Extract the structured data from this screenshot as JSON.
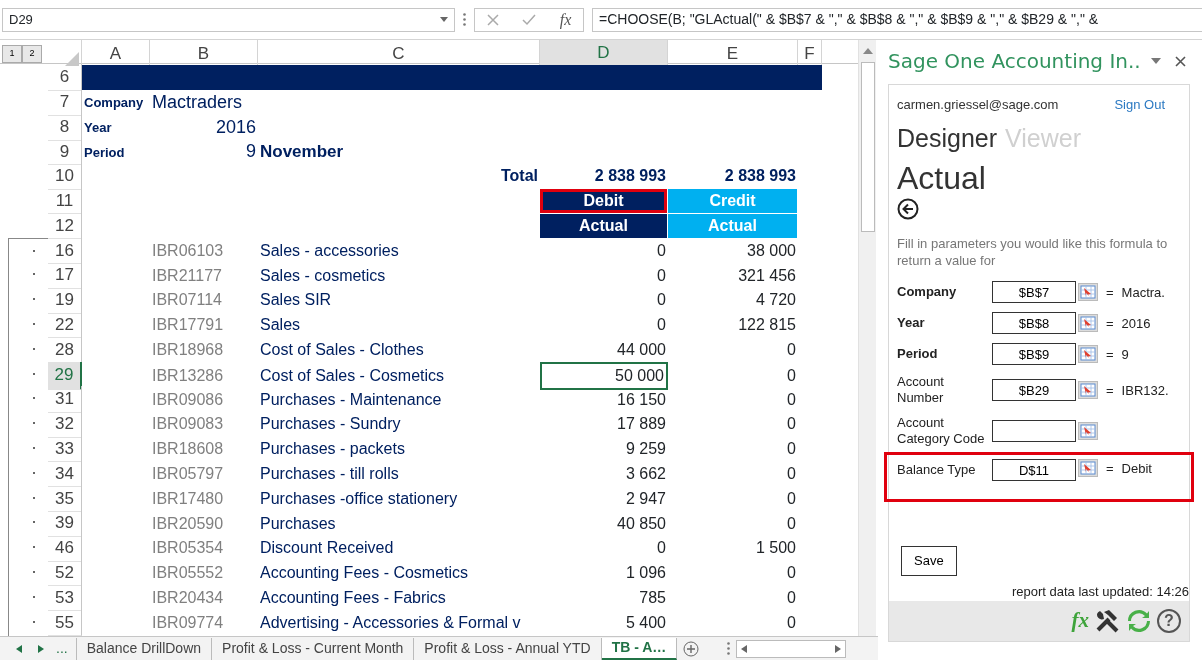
{
  "formula_bar": {
    "name_box": "D29",
    "function_label": "fx",
    "formula": "=CHOOSE(B; \"GLActual(\" & $B$7 & \",\" & $B$8 & \",\" & $B$9 & \",\" & $B29 & \",\" &"
  },
  "outline_levels": [
    "1",
    "2"
  ],
  "columns": [
    {
      "label": "A",
      "selected": false
    },
    {
      "label": "B",
      "selected": false
    },
    {
      "label": "C",
      "selected": false
    },
    {
      "label": "D",
      "selected": true
    },
    {
      "label": "E",
      "selected": false
    },
    {
      "label": "F",
      "selected": false
    }
  ],
  "rows": [
    {
      "number": "6",
      "kind": "band",
      "selected": false
    },
    {
      "number": "7",
      "kind": "info-text",
      "selected": false,
      "label": "Company",
      "value": "Mactraders"
    },
    {
      "number": "8",
      "kind": "info-number",
      "selected": false,
      "label": "Year",
      "value": "2016"
    },
    {
      "number": "9",
      "kind": "info-number",
      "selected": false,
      "label": "Period",
      "value": "9",
      "extra": "November"
    },
    {
      "number": "10",
      "kind": "total",
      "selected": false,
      "c": "Total",
      "d": "2 838 993",
      "e": "2 838 993"
    },
    {
      "number": "11",
      "kind": "head",
      "selected": false,
      "d": {
        "text": "Debit",
        "color": "#002060",
        "outlined": true
      },
      "e": {
        "text": "Credit",
        "color": "#00b0f0",
        "outlined": false
      }
    },
    {
      "number": "12",
      "kind": "head",
      "selected": false,
      "d": {
        "text": "Actual",
        "color": "#002060",
        "outlined": false
      },
      "e": {
        "text": "Actual",
        "color": "#00b0f0",
        "outlined": false
      }
    },
    {
      "number": "16",
      "kind": "data",
      "selected": false,
      "b": "IBR06103",
      "c": "Sales - accessories",
      "d": "0",
      "e": "38 000"
    },
    {
      "number": "17",
      "kind": "data",
      "selected": false,
      "b": "IBR21177",
      "c": "Sales - cosmetics",
      "d": "0",
      "e": "321 456"
    },
    {
      "number": "19",
      "kind": "data",
      "selected": false,
      "b": "IBR07114",
      "c": "Sales SIR",
      "d": "0",
      "e": "4 720"
    },
    {
      "number": "22",
      "kind": "data",
      "selected": false,
      "b": "IBR17791",
      "c": "Sales",
      "d": "0",
      "e": "122 815"
    },
    {
      "number": "28",
      "kind": "data",
      "selected": false,
      "b": "IBR18968",
      "c": "Cost of Sales - Clothes",
      "d": "44 000",
      "e": "0"
    },
    {
      "number": "29",
      "kind": "data",
      "selected": true,
      "b": "IBR13286",
      "c": "Cost of Sales - Cosmetics",
      "d": "50 000",
      "e": "0"
    },
    {
      "number": "31",
      "kind": "data",
      "selected": false,
      "b": "IBR09086",
      "c": "Purchases - Maintenance",
      "d": "16 150",
      "e": "0"
    },
    {
      "number": "32",
      "kind": "data",
      "selected": false,
      "b": "IBR09083",
      "c": "Purchases - Sundry",
      "d": "17 889",
      "e": "0"
    },
    {
      "number": "33",
      "kind": "data",
      "selected": false,
      "b": "IBR18608",
      "c": "Purchases - packets",
      "d": "9 259",
      "e": "0"
    },
    {
      "number": "34",
      "kind": "data",
      "selected": false,
      "b": "IBR05797",
      "c": "Purchases - till rolls",
      "d": "3 662",
      "e": "0"
    },
    {
      "number": "35",
      "kind": "data",
      "selected": false,
      "b": "IBR17480",
      "c": "Purchases -office stationery",
      "d": "2 947",
      "e": "0"
    },
    {
      "number": "39",
      "kind": "data",
      "selected": false,
      "b": "IBR20590",
      "c": "Purchases",
      "d": "40 850",
      "e": "0"
    },
    {
      "number": "46",
      "kind": "data",
      "selected": false,
      "b": "IBR05354",
      "c": "Discount Received",
      "d": "0",
      "e": "1 500"
    },
    {
      "number": "52",
      "kind": "data",
      "selected": false,
      "b": "IBR05552",
      "c": "Accounting Fees - Cosmetics",
      "d": "1 096",
      "e": "0"
    },
    {
      "number": "53",
      "kind": "data",
      "selected": false,
      "b": "IBR20434",
      "c": "Accounting Fees - Fabrics",
      "d": "785",
      "e": "0"
    },
    {
      "number": "55",
      "kind": "data",
      "selected": false,
      "b": "IBR09774",
      "c": "Advertising - Accessories & Formal v",
      "d": "5 400",
      "e": "0"
    }
  ],
  "sheet_tabs": [
    {
      "label": "...",
      "selected": false
    },
    {
      "label": "Balance DrillDown",
      "selected": false
    },
    {
      "label": "Profit & Loss - Current Month",
      "selected": false
    },
    {
      "label": "Profit & Loss - Annual YTD",
      "selected": false
    },
    {
      "label": "TB - A…",
      "selected": true
    }
  ],
  "pane": {
    "title": "Sage One Accounting In..",
    "email": "carmen.griessel@sage.com",
    "sign_out": "Sign Out",
    "modes": [
      {
        "label": "Designer",
        "selected": true
      },
      {
        "label": "Viewer",
        "selected": false
      }
    ],
    "heading": "Actual",
    "instructions": "Fill in parameters you would like this formula to return a value for",
    "params": [
      {
        "label": "Company",
        "bold": true,
        "value": "$B$7",
        "result": "Mactra.",
        "outlined": false
      },
      {
        "label": "Year",
        "bold": true,
        "value": "$B$8",
        "result": "2016",
        "outlined": false
      },
      {
        "label": "Period",
        "bold": true,
        "value": "$B$9",
        "result": "9",
        "outlined": false
      },
      {
        "label": "Account Number",
        "bold": false,
        "value": "$B29",
        "result": "IBR132.",
        "outlined": false
      },
      {
        "label": "Account Category Code",
        "bold": false,
        "outlined": false
      },
      {
        "label": "Balance Type",
        "bold": false,
        "value": "D$11",
        "result": "Debit",
        "outlined": true
      }
    ],
    "equals": "=",
    "save": "Save",
    "updated": "report data last updated: 14:26",
    "toolbar": [
      {
        "kind": "function",
        "label": "fx"
      },
      {
        "kind": "tools"
      },
      {
        "kind": "refresh"
      },
      {
        "kind": "help",
        "label": "?"
      }
    ]
  }
}
